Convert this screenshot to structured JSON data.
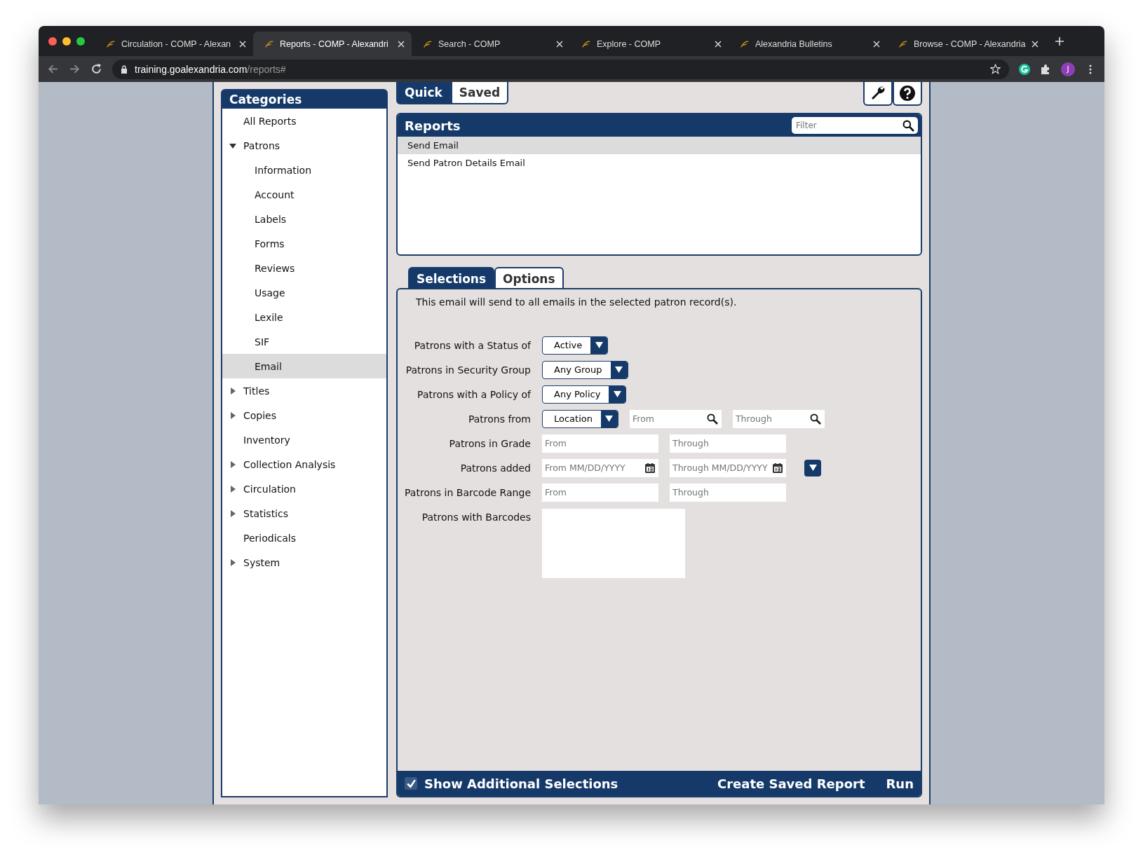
{
  "browser": {
    "tabs": [
      {
        "title": "Circulation - COMP - Alexan",
        "selected": false
      },
      {
        "title": "Reports - COMP - Alexandri",
        "selected": true
      },
      {
        "title": "Search - COMP",
        "selected": false
      },
      {
        "title": "Explore - COMP",
        "selected": false
      },
      {
        "title": "Alexandria Bulletins",
        "selected": false
      },
      {
        "title": "Browse - COMP - Alexandria",
        "selected": false
      }
    ],
    "url": {
      "domain": "training.goalexandria.com",
      "path": "/reports#"
    },
    "avatar": "J"
  },
  "sidebar": {
    "title": "Categories",
    "items": [
      {
        "label": "All Reports",
        "selected": false
      },
      {
        "label": "Patrons",
        "selected": false,
        "expanded": true,
        "children": [
          {
            "label": "Information",
            "selected": false
          },
          {
            "label": "Account",
            "selected": false
          },
          {
            "label": "Labels",
            "selected": false
          },
          {
            "label": "Forms",
            "selected": false
          },
          {
            "label": "Reviews",
            "selected": false
          },
          {
            "label": "Usage",
            "selected": false
          },
          {
            "label": "Lexile",
            "selected": false
          },
          {
            "label": "SIF",
            "selected": false
          },
          {
            "label": "Email",
            "selected": true
          }
        ]
      },
      {
        "label": "Titles",
        "selected": false,
        "expanded": false
      },
      {
        "label": "Copies",
        "selected": false,
        "expanded": false
      },
      {
        "label": "Inventory",
        "selected": false
      },
      {
        "label": "Collection Analysis",
        "selected": false,
        "expanded": false
      },
      {
        "label": "Circulation",
        "selected": false,
        "expanded": false
      },
      {
        "label": "Statistics",
        "selected": false,
        "expanded": false
      },
      {
        "label": "Periodicals",
        "selected": false
      },
      {
        "label": "System",
        "selected": false,
        "expanded": false
      }
    ]
  },
  "mode_tabs": [
    {
      "label": "Quick",
      "selected": true
    },
    {
      "label": "Saved",
      "selected": false
    }
  ],
  "reports": {
    "title": "Reports",
    "filter": {
      "placeholder": "Filter"
    },
    "rows": [
      {
        "label": "Send Email",
        "selected": true
      },
      {
        "label": "Send Patron Details Email",
        "selected": false
      }
    ]
  },
  "panel_tabs": [
    {
      "label": "Selections",
      "selected": true
    },
    {
      "label": "Options",
      "selected": false
    }
  ],
  "selections": {
    "description": "This email will send to all emails in the selected patron record(s).",
    "fields": [
      {
        "kind": "select",
        "label": "Patrons with a Status of",
        "value": "Active"
      },
      {
        "kind": "select",
        "label": "Patrons in Security Group",
        "value": "Any Group"
      },
      {
        "kind": "select",
        "label": "Patrons with a Policy of",
        "value": "Any Policy"
      },
      {
        "kind": "select",
        "label": "Patrons from",
        "value": "Location",
        "inputs": [
          {
            "placeholder": "From",
            "kind": "search"
          },
          {
            "placeholder": "Through",
            "kind": "search"
          }
        ]
      },
      {
        "kind": "range",
        "label": "Patrons in Grade",
        "inputs": [
          {
            "placeholder": "From",
            "kind": "plain"
          },
          {
            "placeholder": "Through",
            "kind": "plain"
          }
        ]
      },
      {
        "kind": "range",
        "label": "Patrons added",
        "menu": true,
        "inputs": [
          {
            "placeholder": "From MM/DD/YYYY",
            "kind": "calendar"
          },
          {
            "placeholder": "Through MM/DD/YYYY",
            "kind": "calendar"
          }
        ]
      },
      {
        "kind": "range",
        "label": "Patrons in Barcode Range",
        "inputs": [
          {
            "placeholder": "From",
            "kind": "plain"
          },
          {
            "placeholder": "Through",
            "kind": "plain"
          }
        ]
      },
      {
        "kind": "textarea",
        "label": "Patrons with Barcodes"
      }
    ]
  },
  "footer": {
    "checkbox": {
      "label": "Show Additional Selections",
      "checked": true
    },
    "actions": [
      "Create Saved Report",
      "Run"
    ]
  }
}
